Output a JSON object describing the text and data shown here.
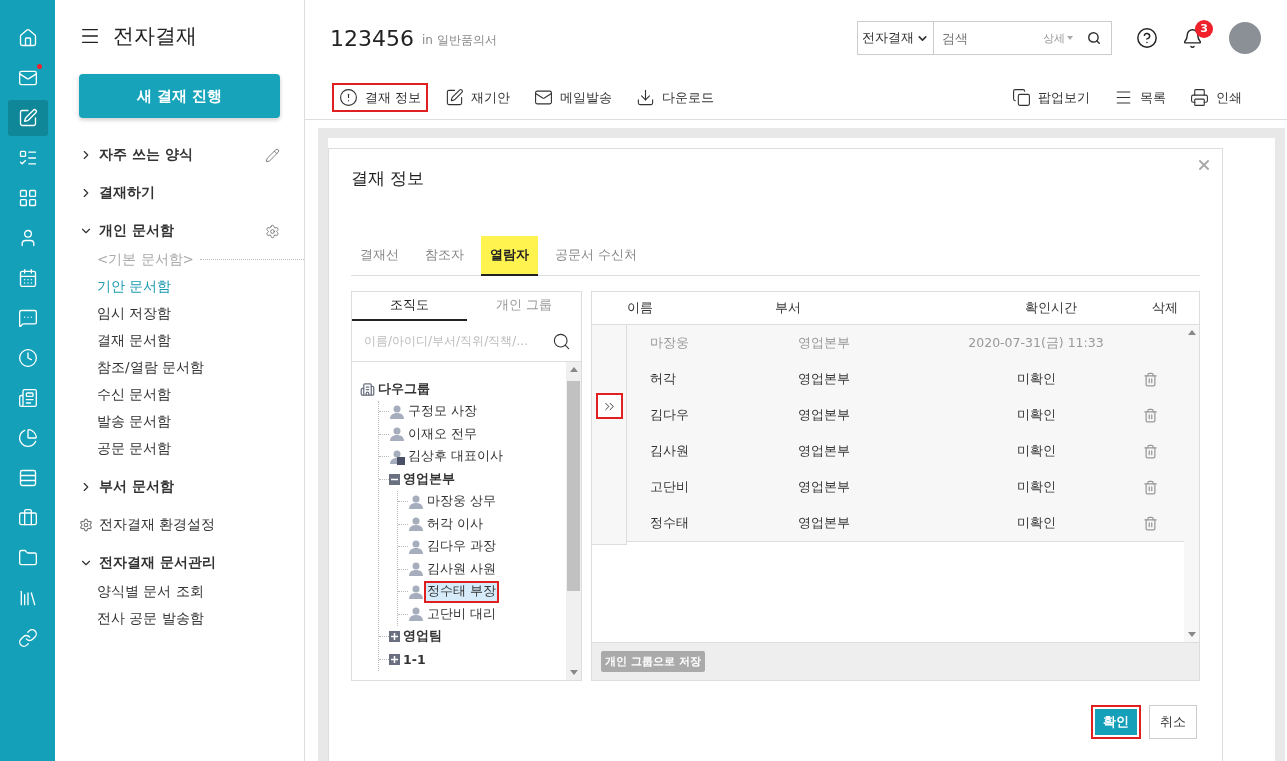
{
  "app_rail": [
    {
      "kind": "home",
      "selected": false,
      "notified": false
    },
    {
      "kind": "mail",
      "selected": false,
      "notified": true
    },
    {
      "kind": "approval",
      "selected": true,
      "notified": false
    },
    {
      "kind": "list",
      "selected": false,
      "notified": false
    },
    {
      "kind": "grid",
      "selected": false,
      "notified": false
    },
    {
      "kind": "person",
      "selected": false,
      "notified": false
    },
    {
      "kind": "calendar",
      "selected": false,
      "notified": false
    },
    {
      "kind": "chat",
      "selected": false,
      "notified": false
    },
    {
      "kind": "clock",
      "selected": false,
      "notified": false
    },
    {
      "kind": "report",
      "selected": false,
      "notified": false
    },
    {
      "kind": "survey",
      "selected": false,
      "notified": false
    },
    {
      "kind": "rows",
      "selected": false,
      "notified": false
    },
    {
      "kind": "briefcase",
      "selected": false,
      "notified": false
    },
    {
      "kind": "folder",
      "selected": false,
      "notified": false
    },
    {
      "kind": "library",
      "selected": false,
      "notified": false
    },
    {
      "kind": "link",
      "selected": false,
      "notified": false
    }
  ],
  "sidebar": {
    "title": "전자결재",
    "new_button": "새 결재 진행",
    "sections": [
      {
        "kind": "group",
        "label": "자주 쓰는 양식",
        "expanded": false,
        "edit_button": true
      },
      {
        "kind": "group",
        "label": "결재하기",
        "expanded": false
      },
      {
        "kind": "group",
        "label": "개인 문서함",
        "expanded": true,
        "settings_button": true,
        "items": [
          {
            "kind": "caption",
            "label": "<기본 문서함>"
          },
          {
            "kind": "link",
            "label": "기안 문서함",
            "selected": true
          },
          {
            "kind": "link",
            "label": "임시 저장함",
            "selected": false
          },
          {
            "kind": "link",
            "label": "결재 문서함",
            "selected": false
          },
          {
            "kind": "link",
            "label": "참조/열람 문서함",
            "selected": false
          },
          {
            "kind": "link",
            "label": "수신 문서함",
            "selected": false
          },
          {
            "kind": "link",
            "label": "발송 문서함",
            "selected": false
          },
          {
            "kind": "link",
            "label": "공문 문서함",
            "selected": false
          }
        ]
      },
      {
        "kind": "group",
        "label": "부서 문서함",
        "expanded": false
      },
      {
        "kind": "setting",
        "label": "전자결재 환경설정"
      },
      {
        "kind": "group",
        "label": "전자결재 문서관리",
        "expanded": true,
        "items": [
          {
            "kind": "link",
            "label": "양식별 문서 조회",
            "selected": false
          },
          {
            "kind": "link",
            "label": "전사 공문 발송함",
            "selected": false
          }
        ]
      }
    ]
  },
  "header": {
    "doc_number": "123456",
    "doc_form": "in 일반품의서",
    "search": {
      "scope": "전자결재",
      "placeholder": "검색",
      "detail": "상세"
    },
    "notification_count": "3"
  },
  "toolbar": {
    "left": [
      {
        "kind": "info",
        "label": "결재 정보",
        "highlighted": true
      },
      {
        "kind": "edit",
        "label": "재기안",
        "highlighted": false
      },
      {
        "kind": "mail",
        "label": "메일발송",
        "highlighted": false
      },
      {
        "kind": "download",
        "label": "다운로드",
        "highlighted": false
      }
    ],
    "right": [
      {
        "kind": "popup",
        "label": "팝업보기"
      },
      {
        "kind": "list",
        "label": "목록"
      },
      {
        "kind": "print",
        "label": "인쇄"
      }
    ]
  },
  "modal": {
    "title": "결재 정보",
    "tabs": [
      {
        "label": "결재선",
        "selected": false,
        "highlighted": false
      },
      {
        "label": "참조자",
        "selected": false,
        "highlighted": false
      },
      {
        "label": "열람자",
        "selected": true,
        "highlighted": true
      },
      {
        "label": "공문서 수신처",
        "selected": false,
        "highlighted": false
      }
    ],
    "org_tabs": [
      {
        "label": "조직도",
        "selected": true
      },
      {
        "label": "개인 그룹",
        "selected": false
      }
    ],
    "org_search": {
      "placeholder": "이름/아이디/부서/직위/직책/…"
    },
    "tree": [
      {
        "kind": "org",
        "label": "다우그룹",
        "expanded": true,
        "selected": false,
        "children": [
          {
            "kind": "person",
            "label": "구정모 사장",
            "selected": false
          },
          {
            "kind": "person",
            "label": "이재오 전무",
            "selected": false
          },
          {
            "kind": "manager",
            "label": "김상후 대표이사",
            "selected": false
          },
          {
            "kind": "dept",
            "label": "영업본부",
            "expanded": true,
            "selected": false,
            "children": [
              {
                "kind": "person",
                "label": "마장웅 상무",
                "selected": false
              },
              {
                "kind": "person",
                "label": "허각 이사",
                "selected": false
              },
              {
                "kind": "person",
                "label": "김다우 과장",
                "selected": false
              },
              {
                "kind": "person",
                "label": "김사원 사원",
                "selected": false
              },
              {
                "kind": "person",
                "label": "정수태 부장",
                "selected": true
              },
              {
                "kind": "person",
                "label": "고단비 대리",
                "selected": false
              }
            ]
          },
          {
            "kind": "dept",
            "label": "영업팀",
            "expanded": false,
            "selected": false
          },
          {
            "kind": "dept",
            "label": "1-1",
            "expanded": false,
            "selected": false
          }
        ]
      }
    ],
    "add_button_highlighted": true,
    "columns": [
      "이름",
      "부서",
      "확인시간",
      "삭제"
    ],
    "rows": [
      {
        "name": "마장웅",
        "dept": "영업본부",
        "time": "2020-07-31(금) 11:33",
        "confirmed": true
      },
      {
        "name": "허각",
        "dept": "영업본부",
        "time": "미확인",
        "confirmed": false
      },
      {
        "name": "김다우",
        "dept": "영업본부",
        "time": "미확인",
        "confirmed": false
      },
      {
        "name": "김사원",
        "dept": "영업본부",
        "time": "미확인",
        "confirmed": false
      },
      {
        "name": "고단비",
        "dept": "영업본부",
        "time": "미확인",
        "confirmed": false
      },
      {
        "name": "정수태",
        "dept": "영업본부",
        "time": "미확인",
        "confirmed": false
      }
    ],
    "save_group_button": "개인 그룹으로 저장",
    "buttons": [
      {
        "kind": "primary",
        "label": "확인",
        "highlighted": true
      },
      {
        "kind": "secondary",
        "label": "취소",
        "highlighted": false
      }
    ]
  }
}
